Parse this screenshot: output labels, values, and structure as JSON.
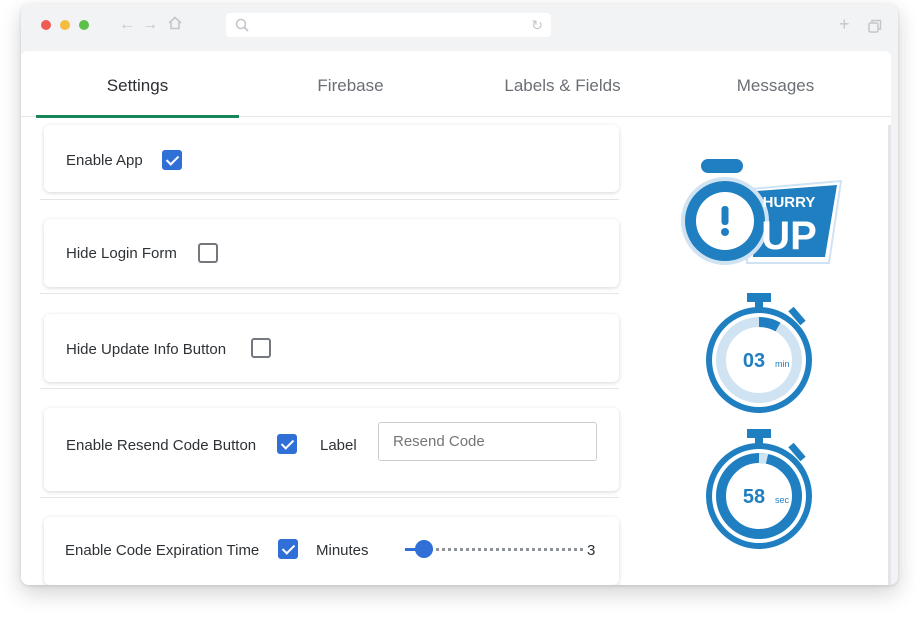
{
  "browser": {
    "nav_icons": [
      "back-arrow-icon",
      "forward-arrow-icon",
      "home-icon"
    ],
    "url": "",
    "toolbar_icons": [
      "new-tab-plus-icon",
      "duplicate-window-icon"
    ]
  },
  "tabs": [
    {
      "label": "Settings",
      "active": true
    },
    {
      "label": "Firebase",
      "active": false
    },
    {
      "label": "Labels & Fields",
      "active": false
    },
    {
      "label": "Messages",
      "active": false
    }
  ],
  "settings": {
    "enable_app": {
      "label": "Enable App",
      "checked": true
    },
    "hide_login_form": {
      "label": "Hide Login Form",
      "checked": false
    },
    "hide_update_info_button": {
      "label": "Hide Update Info Button",
      "checked": false
    },
    "enable_resend_code_button": {
      "label": "Enable Resend Code Button",
      "checked": true,
      "field_label": "Label",
      "placeholder": "Resend Code"
    },
    "enable_code_expiration_time": {
      "label": "Enable Code Expiration Time",
      "checked": true,
      "slider_label": "Minutes",
      "value": "3",
      "slider_fraction": 0.08
    }
  },
  "illustrations": {
    "hurry_up": {
      "line1": "HURRY",
      "line2": "UP"
    },
    "timer_minutes": {
      "value": "03",
      "unit": "min"
    },
    "timer_seconds": {
      "value": "58",
      "unit": "sec"
    }
  },
  "colors": {
    "accent_green": "#17875a",
    "checkbox_blue": "#2f6fd6",
    "illustration_blue": "#1f7fc0"
  }
}
